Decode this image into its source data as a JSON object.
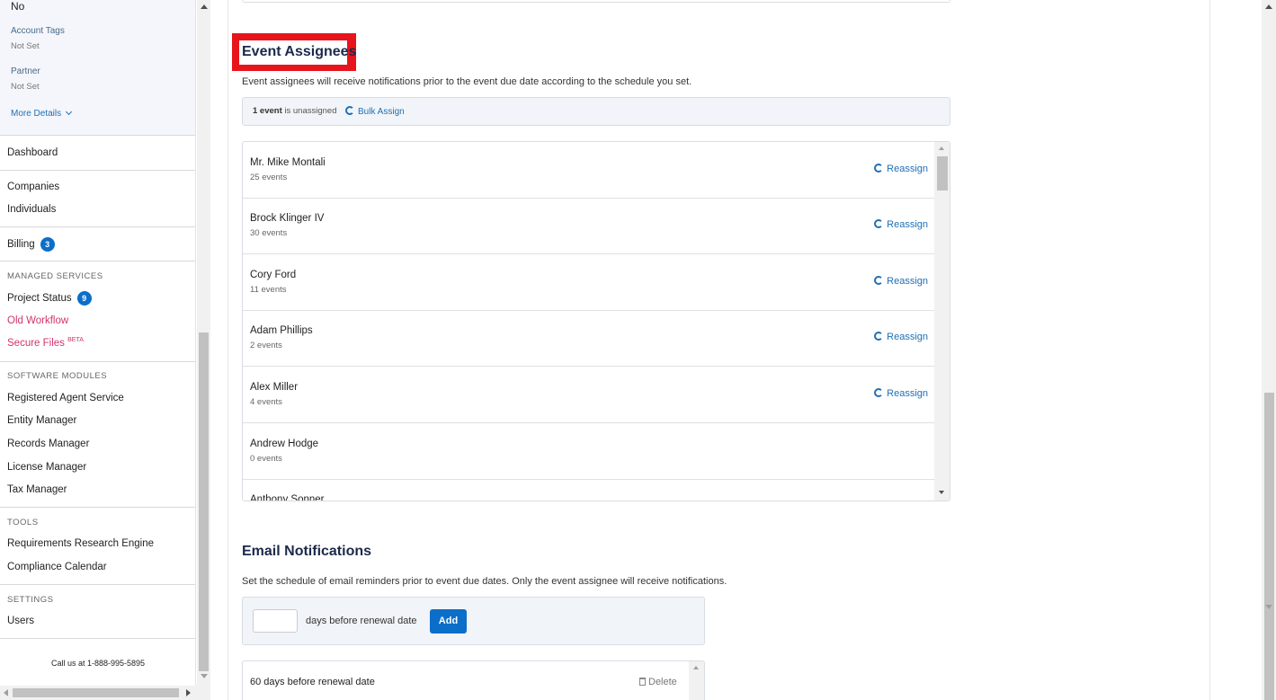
{
  "sidebar": {
    "top": {
      "no_value": "No",
      "account_tags_label": "Account Tags",
      "account_tags_value": "Not Set",
      "partner_label": "Partner",
      "partner_value": "Not Set",
      "more_details": "More Details"
    },
    "dashboard": "Dashboard",
    "companies": "Companies",
    "individuals": "Individuals",
    "billing": "Billing",
    "billing_badge": "3",
    "managed_services_heading": "MANAGED SERVICES",
    "project_status": "Project Status",
    "project_status_badge": "9",
    "old_workflow": "Old Workflow",
    "secure_files": "Secure Files",
    "secure_files_beta": "BETA",
    "software_modules_heading": "SOFTWARE MODULES",
    "registered_agent_service": "Registered Agent Service",
    "entity_manager": "Entity Manager",
    "records_manager": "Records Manager",
    "license_manager": "License Manager",
    "tax_manager": "Tax Manager",
    "tools_heading": "TOOLS",
    "requirements_research_engine": "Requirements Research Engine",
    "compliance_calendar": "Compliance Calendar",
    "settings_heading": "SETTINGS",
    "users": "Users",
    "call_us": "Call us at 1-888-995-5895"
  },
  "event_assignees": {
    "title": "Event Assignees",
    "description": "Event assignees will receive notifications prior to the event due date according to the schedule you set.",
    "unassigned_count": "1 event",
    "unassigned_suffix": " is unassigned",
    "bulk_assign": "Bulk Assign",
    "reassign_label": "Reassign",
    "assignees": [
      {
        "name": "Mr. Mike Montali",
        "events": "25 events",
        "reassign": true
      },
      {
        "name": "Brock Klinger IV",
        "events": "30 events",
        "reassign": true
      },
      {
        "name": "Cory Ford",
        "events": "11 events",
        "reassign": true
      },
      {
        "name": "Adam Phillips",
        "events": "2 events",
        "reassign": true
      },
      {
        "name": "Alex Miller",
        "events": "4 events",
        "reassign": true
      },
      {
        "name": "Andrew Hodge",
        "events": "0 events",
        "reassign": false
      },
      {
        "name": "Anthony Sonner",
        "events": "",
        "reassign": false
      }
    ]
  },
  "email_notifications": {
    "title": "Email Notifications",
    "description": "Set the schedule of email reminders prior to event due dates. Only the event assignee will receive notifications.",
    "days_input_value": "",
    "days_label": "days before renewal date",
    "add_button": "Add",
    "schedule": [
      {
        "label": "60 days before renewal date",
        "delete": "Delete"
      }
    ]
  },
  "colors": {
    "accent": "#0b6ec9",
    "link": "#1f6fb5",
    "highlight": "#e8141c",
    "pink": "#d2336e"
  }
}
